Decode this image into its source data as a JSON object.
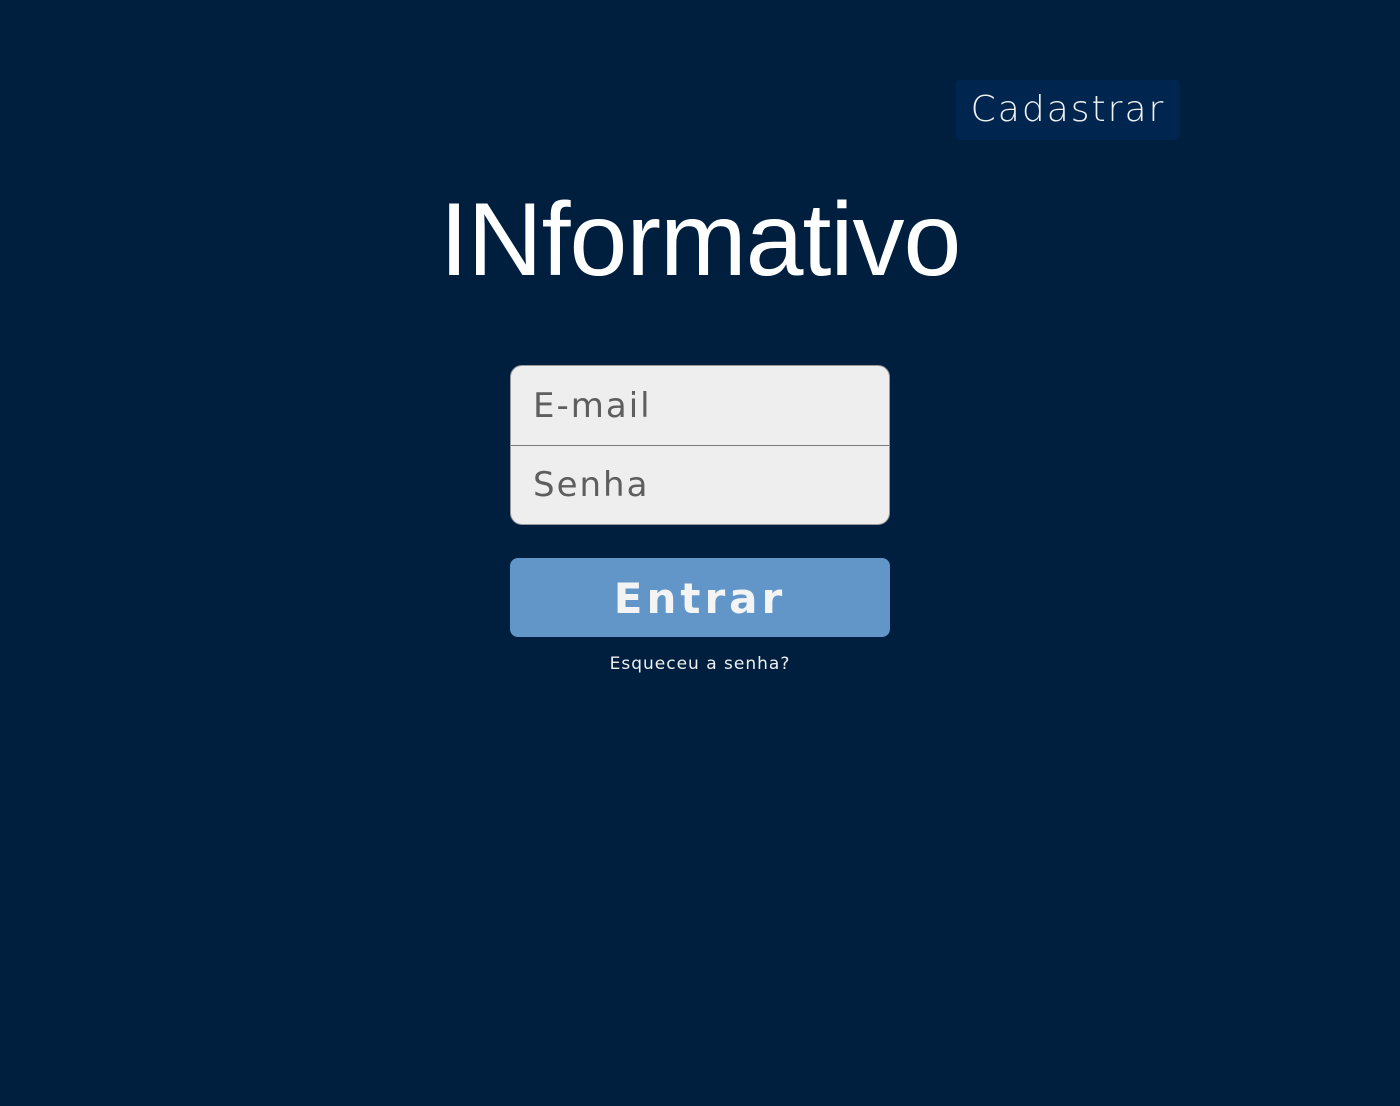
{
  "header": {
    "register_label": "Cadastrar"
  },
  "page": {
    "title": "INformativo"
  },
  "login": {
    "email_placeholder": "E-mail",
    "password_placeholder": "Senha",
    "submit_label": "Entrar",
    "forgot_password_label": "Esqueceu a senha?"
  },
  "colors": {
    "background": "#001f3f",
    "register_button": "#00264f",
    "submit_button": "#6296c9",
    "field_background": "#eeeeee"
  }
}
